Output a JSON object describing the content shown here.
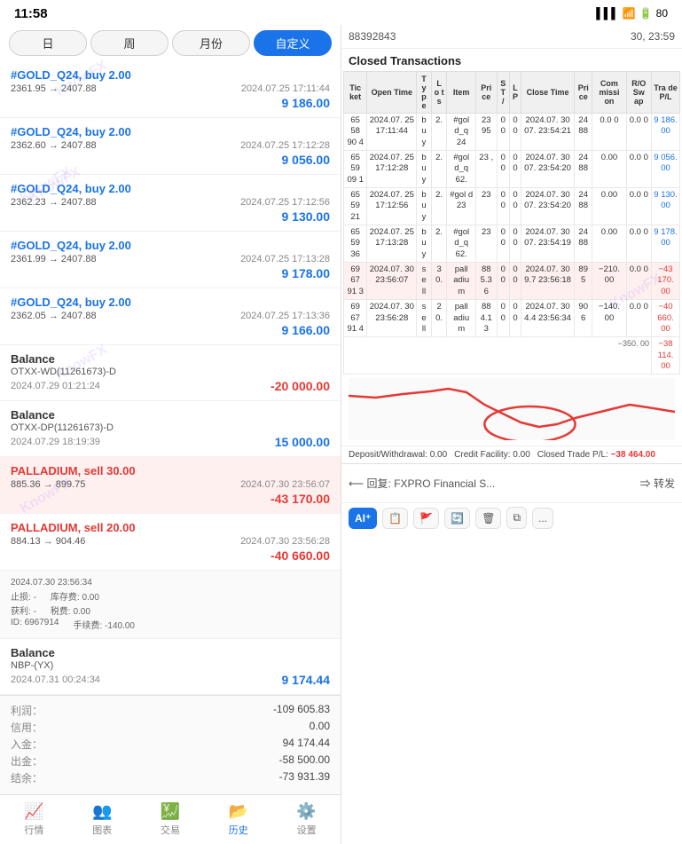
{
  "statusBar": {
    "time": "11:58",
    "signal": "▌▌▌",
    "wifi": "WiFi",
    "battery": "80"
  },
  "rightHeader": {
    "id": "88392843",
    "date": "30, 23:59"
  },
  "sectionTitle": "Closed Transactions",
  "tabs": [
    {
      "label": "日",
      "active": false
    },
    {
      "label": "周",
      "active": false
    },
    {
      "label": "月份",
      "active": false
    },
    {
      "label": "自定义",
      "active": true
    }
  ],
  "transactions": [
    {
      "title": "#GOLD_Q24, buy 2.00",
      "titleClass": "buy",
      "price": "2361.95 → 2407.88",
      "datetime": "2024.07.25 17:11:44",
      "amount": "9 186.00",
      "amountClass": "positive"
    },
    {
      "title": "#GOLD_Q24, buy 2.00",
      "titleClass": "buy",
      "price": "2362.60 → 2407.88",
      "datetime": "2024.07.25 17:12:28",
      "amount": "9 056.00",
      "amountClass": "positive"
    },
    {
      "title": "#GOLD_Q24, buy 2.00",
      "titleClass": "buy",
      "price": "2362.23 → 2407.88",
      "datetime": "2024.07.25 17:12:56",
      "amount": "9 130.00",
      "amountClass": "positive"
    },
    {
      "title": "#GOLD_Q24, buy 2.00",
      "titleClass": "buy",
      "price": "2361.99 → 2407.88",
      "datetime": "2024.07.25 17:13:28",
      "amount": "9 178.00",
      "amountClass": "positive"
    },
    {
      "title": "#GOLD_Q24, buy 2.00",
      "titleClass": "buy",
      "price": "2362.05 → 2407.88",
      "datetime": "2024.07.25 17:13:36",
      "amount": "9 166.00",
      "amountClass": "positive"
    },
    {
      "title": "Balance",
      "titleClass": "balance",
      "sub": "OTXX-WD(11261673)-D",
      "datetime": "2024.07.29 01:21:24",
      "amount": "-20 000.00",
      "amountClass": "negative"
    },
    {
      "title": "Balance",
      "titleClass": "balance",
      "sub": "OTXX-DP(11261673)-D",
      "datetime": "2024.07.29 18:19:39",
      "amount": "15 000.00",
      "amountClass": "positive"
    },
    {
      "title": "PALLADIUM, sell 30.00",
      "titleClass": "sell",
      "price": "885.36 → 899.75",
      "datetime": "2024.07.30 23:56:07",
      "amount": "-43 170.00",
      "amountClass": "negative",
      "highlighted": true
    },
    {
      "title": "PALLADIUM, sell 20.00",
      "titleClass": "sell",
      "price": "884.13 → 904.46",
      "datetime": "2024.07.30 23:56:28",
      "amount": "-40 660.00",
      "amountClass": "negative"
    },
    {
      "title": "Balance",
      "titleClass": "balance",
      "sub": "NBP-(YX)",
      "datetime": "2024.07.31 00:24:34",
      "amount": "9 174.44",
      "amountClass": "positive"
    }
  ],
  "subInfo": {
    "date": "2024.07.30 23:56:34",
    "stopLoss": "-",
    "fees": "0.00",
    "profit": "-",
    "tax": "0.00",
    "id": "6967914",
    "continuationFee": "-140.00"
  },
  "totals": {
    "profit": "-109 605.83",
    "credit": "0.00",
    "deposit": "94 174.44",
    "withdrawal": "-58 500.00",
    "balance": "-73 931.39"
  },
  "tableColumns": [
    "Ticket",
    "Open Time",
    "Type",
    "Lots",
    "Item",
    "Price",
    "S/T",
    "L/P",
    "Close Time",
    "Price",
    "Commission",
    "R/O Swap",
    "Trade P/L"
  ],
  "tableRows": [
    [
      "6558 904",
      "2024.07. 25 17:11:44",
      "b u y",
      "2.",
      "#gol d_q 24",
      "23 95",
      "0 0",
      "0 0",
      "2024.07. 30 07. 23:54:21",
      "24 88",
      "0.0 0",
      "0.0 0",
      "9 186. 00"
    ],
    [
      "6559 09 1",
      "2024.07. 25 17:12:28",
      "b u y",
      "2.",
      "#gol d_q 62.",
      "23 ,",
      "0 0",
      "0 0",
      "2024.07. 30 07. 23:54:20",
      "24 88",
      "0.00",
      "0.0 0",
      "9 056. 00"
    ],
    [
      "6559 21",
      "2024.07. 25 17:12:56",
      "b u y",
      "2.",
      "#gol d 23",
      "23",
      "0 0",
      "0 0",
      "2024.07. 30 07. 23:54:20",
      "24 88",
      "0.00",
      "0.0 0",
      "9 130. 00"
    ],
    [
      "6559 36",
      "2024.07. 25 17:13:28",
      "b u y",
      "2.",
      "#gol d_q 62.",
      "23",
      "0 0",
      "0 0",
      "2024.07. 30 07. 23:54:19",
      "24 88",
      "0.00",
      "0.0 0",
      "9 178. 00"
    ],
    [
      "6967 91 3",
      "2024.07. 30 23:56:07",
      "s e ll",
      "3 0.",
      "pall adiu m",
      "88 5.3 6",
      "0 0",
      "0 0",
      "2024.07. 30 9.7 23:56:18",
      "89 5",
      "−210. 00",
      "0.0 0",
      "−43 170. 00"
    ],
    [
      "6967 91 4",
      "2024.07. 30 23:56:28",
      "s e ll",
      "2 0.",
      "pall adiu m",
      "88 4.1 3",
      "0 0",
      "0 0",
      "2024.07. 30 4.4 23:56:34",
      "90 6",
      "−140. 00",
      "0.0 0",
      "−40 660. 00"
    ]
  ],
  "summary": {
    "deposit": "Deposit/Withdrawal: 0.00",
    "credit": "Credit Facility: 0.00",
    "closedLabel": "Closed Trade P/L:",
    "closedValue": "−38 464.00"
  },
  "bottomLine": {
    "extra": "−38 114.00"
  },
  "toolbar": {
    "replyLabel": "⟵ 回复: FXPRO Financial S...",
    "forwardLabel": "⇒ 转发",
    "ai": "AI⁺",
    "btn1": "📋",
    "btn2": "🚩",
    "btn3": "🔄",
    "btn4": "🗑",
    "btn5": "⧉",
    "btn6": "..."
  },
  "bottomNav": [
    {
      "label": "行情",
      "icon": "📈",
      "active": false
    },
    {
      "label": "图表",
      "icon": "👥",
      "active": false
    },
    {
      "label": "交易",
      "icon": "💹",
      "active": false
    },
    {
      "label": "历史",
      "icon": "📂",
      "active": true
    },
    {
      "label": "设置",
      "icon": "⚙️",
      "active": false
    }
  ]
}
